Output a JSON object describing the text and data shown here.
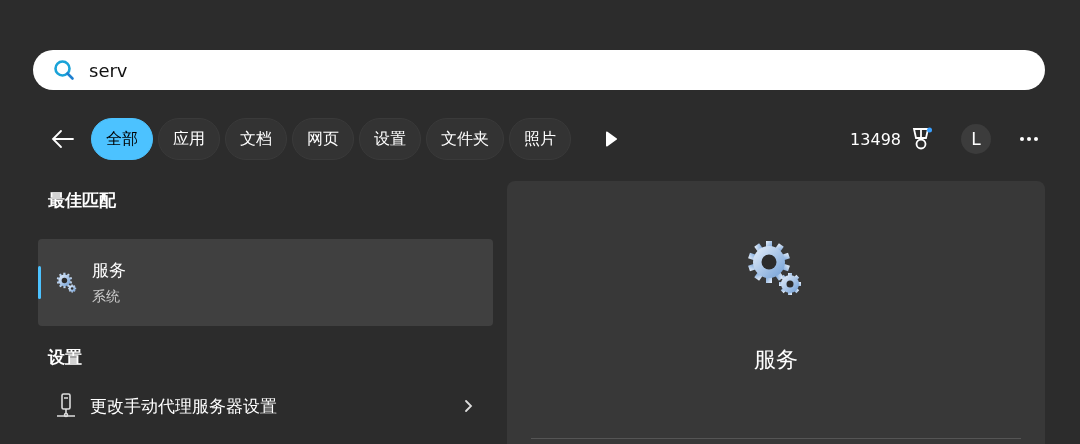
{
  "search": {
    "value": "serv"
  },
  "filters": [
    {
      "label": "全部",
      "selected": true
    },
    {
      "label": "应用",
      "selected": false
    },
    {
      "label": "文档",
      "selected": false
    },
    {
      "label": "网页",
      "selected": false
    },
    {
      "label": "设置",
      "selected": false
    },
    {
      "label": "文件夹",
      "selected": false
    },
    {
      "label": "照片",
      "selected": false
    }
  ],
  "rewards": {
    "points": "13498"
  },
  "account": {
    "initial": "L"
  },
  "sections": [
    {
      "title": "最佳匹配",
      "items": [
        {
          "title": "服务",
          "subtitle": "系统",
          "kind": "app",
          "selected": true
        }
      ]
    },
    {
      "title": "设置",
      "items": [
        {
          "title": "更改手动代理服务器设置",
          "kind": "setting",
          "selected": false
        }
      ]
    }
  ],
  "preview": {
    "title": "服务"
  }
}
